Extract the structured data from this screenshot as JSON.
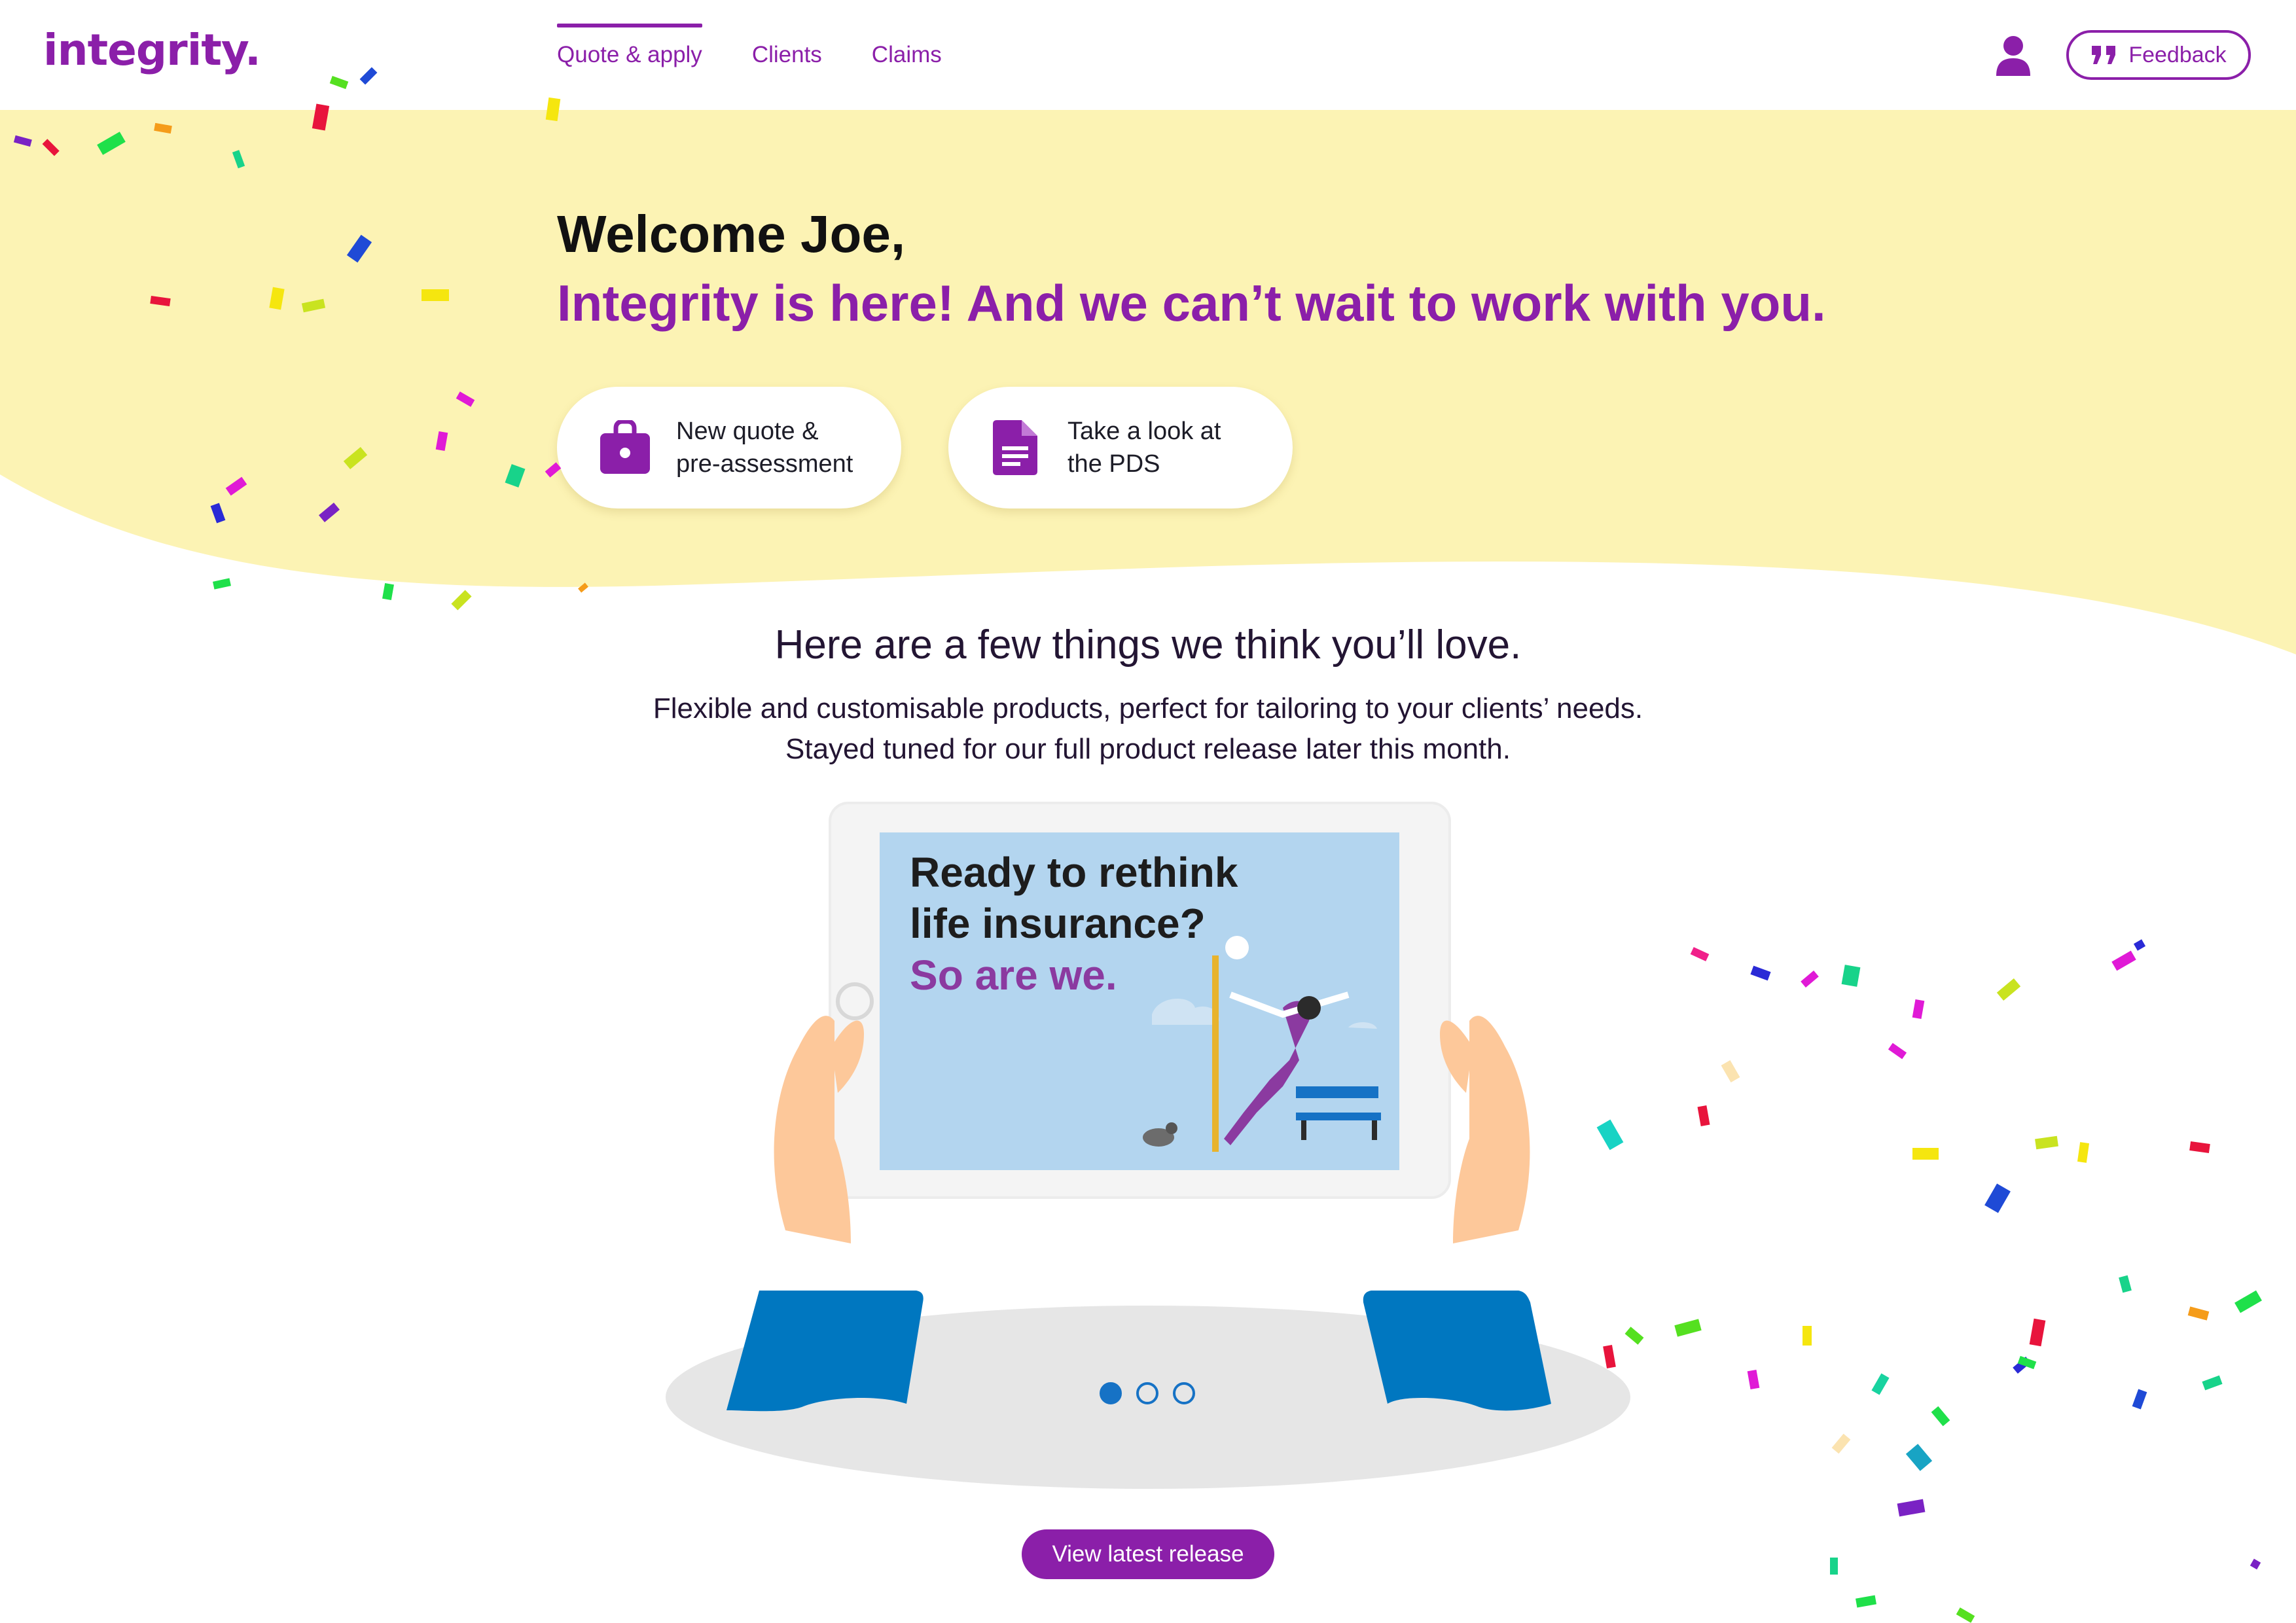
{
  "header": {
    "logo": "integrity.",
    "nav": [
      {
        "label": "Quote & apply",
        "active": true
      },
      {
        "label": "Clients",
        "active": false
      },
      {
        "label": "Claims",
        "active": false
      }
    ],
    "user_icon": "user-icon",
    "feedback_label": "Feedback",
    "feedback_icon": "quote-marks-icon"
  },
  "hero": {
    "greeting": "Welcome Joe,",
    "subtitle": "Integrity is here! And we can’t wait to work with you.",
    "actions": [
      {
        "line1": "New quote &",
        "line2": "pre-assessment",
        "icon": "briefcase-icon"
      },
      {
        "line1": "Take a look at",
        "line2": "the PDS",
        "icon": "document-icon"
      }
    ]
  },
  "features": {
    "title": "Here are a few things we think you’ll love.",
    "line1": "Flexible and customisable products, perfect for tailoring to your clients’ needs.",
    "line2": "Stayed tuned for our full product release later this month."
  },
  "tablet": {
    "headline1": "Ready to rethink",
    "headline2": "life insurance?",
    "headline3": "So are we."
  },
  "carousel": {
    "slides": 3,
    "active": 0
  },
  "release_button": "View latest release",
  "colors": {
    "brand_purple": "#8b1fa9",
    "hero_yellow": "#fcf3b4",
    "accent_blue": "#1672c5",
    "sleeve_blue": "#0077c0",
    "skin": "#fdc89a"
  }
}
